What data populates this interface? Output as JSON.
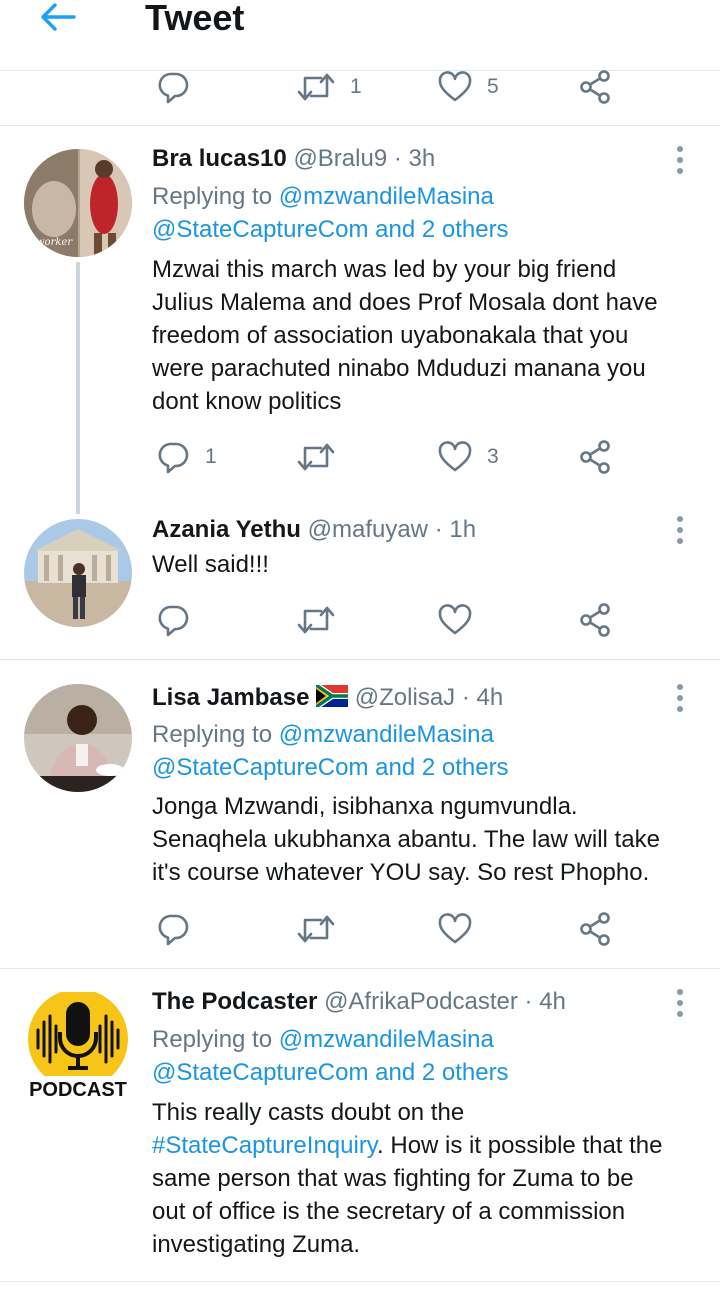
{
  "header": {
    "title": "Tweet"
  },
  "top_actions": {
    "retweets": "1",
    "likes": "5"
  },
  "tweets": [
    {
      "name": "Bra lucas10",
      "handle": "@Bralu9",
      "dot": "·",
      "time": "3h",
      "replying_prefix": "Replying to",
      "replying_user": "@mzwandileMasina",
      "replying_line2": "@StateCaptureCom and 2 others",
      "text_lines": [
        "Mzwai this march was led by your big friend",
        "Julius Malema and does Prof Mosala dont have",
        "freedom of association uyabonakala that you",
        "were parachuted ninabo Mduduzi  manana you",
        "dont know politics"
      ],
      "avatar_caption": "worker",
      "replies": "1",
      "retweets": "",
      "likes": "3"
    },
    {
      "name": "Azania Yethu",
      "handle": "@mafuyaw",
      "dot": "·",
      "time": "1h",
      "text_lines": [
        "Well said!!!"
      ],
      "replies": "",
      "retweets": "",
      "likes": ""
    },
    {
      "name": "Lisa Jambase",
      "flag": "🇿🇦",
      "handle": "@ZolisaJ",
      "dot": "·",
      "time": "4h",
      "replying_prefix": "Replying to",
      "replying_user": "@mzwandileMasina",
      "replying_line2": "@StateCaptureCom and 2 others",
      "text_lines": [
        "Jonga Mzwandi, isibhanxa ngumvundla.",
        "Senaqhela ukubhanxa abantu. The law will take",
        "it's course whatever YOU say. So rest Phopho."
      ],
      "replies": "",
      "retweets": "",
      "likes": ""
    },
    {
      "name": "The Podcaster",
      "handle": "@AfrikaPodcaster",
      "dot": "·",
      "time": "4h",
      "replying_prefix": "Replying to",
      "replying_user": "@mzwandileMasina",
      "replying_line2": "@StateCaptureCom and 2 others",
      "text_line1": "This really casts doubt on the",
      "hashtag": "#StateCaptureInquiry",
      "text_line2_rest": ". How is it possible that the",
      "text_lines_rest": [
        "same person that was fighting for Zuma to be",
        "out of office is the secretary of a commission",
        "investigating Zuma."
      ],
      "avatar_text": "PODCAST"
    }
  ],
  "colors": {
    "accent": "#1da1f2",
    "link": "#1b95e0",
    "muted": "#657786",
    "divider": "#e1e8ed"
  },
  "icons": [
    "back-arrow-icon",
    "reply-icon",
    "retweet-icon",
    "like-icon",
    "share-icon",
    "more-vertical-icon"
  ]
}
